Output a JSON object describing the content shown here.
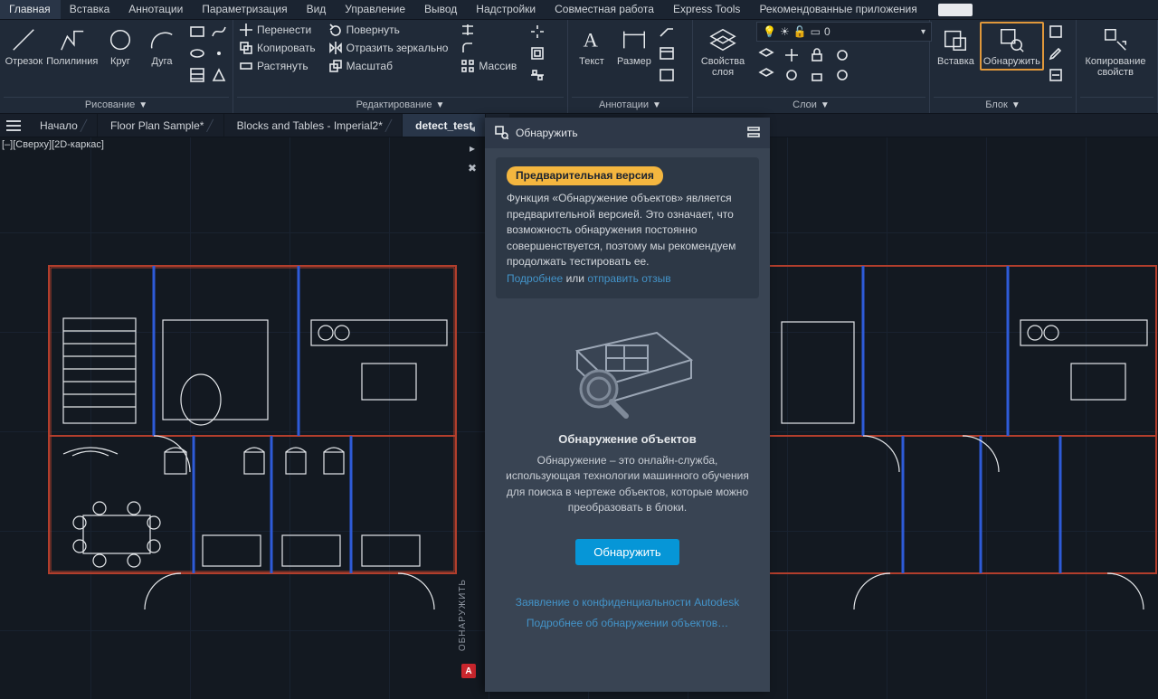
{
  "menubar": {
    "tabs": [
      "Главная",
      "Вставка",
      "Аннотации",
      "Параметризация",
      "Вид",
      "Управление",
      "Вывод",
      "Надстройки",
      "Совместная работа",
      "Express Tools",
      "Рекомендованные приложения"
    ],
    "active_index": 0
  },
  "ribbon": {
    "draw": {
      "title": "Рисование",
      "line": "Отрезок",
      "polyline": "Полилиния",
      "circle": "Круг",
      "arc": "Дуга"
    },
    "modify": {
      "title": "Редактирование",
      "move": "Перенести",
      "rotate": "Повернуть",
      "copy": "Копировать",
      "mirror": "Отразить зеркально",
      "stretch": "Растянуть",
      "scale": "Масштаб",
      "array": "Массив"
    },
    "annot": {
      "title": "Аннотации",
      "text": "Текст",
      "dim": "Размер"
    },
    "layers": {
      "title": "Слои",
      "props": "Свойства\nслоя",
      "current": "0"
    },
    "block": {
      "title": "Блок",
      "insert": "Вставка",
      "detect": "Обнаружить"
    },
    "props": {
      "title": "",
      "copyprops": "Копирование\nсвойств"
    }
  },
  "doctabs": {
    "items": [
      "Начало",
      "Floor Plan Sample*",
      "Blocks and Tables - Imperial2*",
      "detect_test"
    ],
    "active_index": 3
  },
  "viewlabel": "[–][Сверху][2D-каркас]",
  "detect_panel": {
    "title": "Обнаружить",
    "badge": "Предварительная версия",
    "info_text": "Функция «Обнаружение объектов» является предварительной версией. Это означает, что возможность обнаружения постоянно совершенствуется, поэтому мы рекомендуем продолжать тестировать ее.",
    "link_more": "Подробнее",
    "info_or": "или",
    "link_feedback": "отправить отзыв",
    "heading": "Обнаружение объектов",
    "description": "Обнаружение – это онлайн-служба, использующая технологии машинного обучения для поиска в чертеже объектов, которые можно преобразовать в блоки.",
    "cta": "Обнаружить",
    "privacy": "Заявление о конфиденциальности Autodesk",
    "learn": "Подробнее об обнаружении объектов…",
    "side_label": "ОБНАРУЖИТЬ",
    "side_badge": "A"
  }
}
